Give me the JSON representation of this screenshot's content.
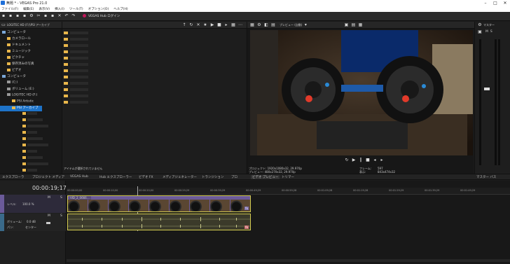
{
  "window": {
    "title": "無題 * - VEGAS Pro 21.0",
    "min": "–",
    "max": "□",
    "close": "✕"
  },
  "menu": [
    "ファイル(F)",
    "編集(E)",
    "表示(V)",
    "挿入(I)",
    "ツール(T)",
    "オプション(O)",
    "ヘルプ(H)"
  ],
  "toolbar": {
    "hub_label": "VEGAS Hub ログイン"
  },
  "explorer": {
    "path": "LOGITEC HD (F:)\\PSI アーカイブ",
    "tree": [
      {
        "label": "コンピュータ",
        "indent": 0,
        "type": "pc"
      },
      {
        "label": "カメラロール",
        "indent": 1,
        "type": "folder"
      },
      {
        "label": "ドキュメント",
        "indent": 1,
        "type": "folder"
      },
      {
        "label": "ミュージック",
        "indent": 1,
        "type": "folder"
      },
      {
        "label": "ピクチャ",
        "indent": 1,
        "type": "folder"
      },
      {
        "label": "保存済みの写真",
        "indent": 1,
        "type": "folder"
      },
      {
        "label": "ビデオ",
        "indent": 1,
        "type": "folder"
      },
      {
        "label": "コンピュータ",
        "indent": 0,
        "type": "pc"
      },
      {
        "label": "(C:)",
        "indent": 1,
        "type": "drive"
      },
      {
        "label": "ボリューム (E:)",
        "indent": 1,
        "type": "drive"
      },
      {
        "label": "LOGITEC HD (F:)",
        "indent": 1,
        "type": "drive"
      },
      {
        "label": "PSI Artistic",
        "indent": 2,
        "type": "folder"
      },
      {
        "label": "PSI アーカイブ",
        "indent": 2,
        "type": "folder",
        "selected": true
      }
    ],
    "status": "アイテムが選択されていません"
  },
  "preview": {
    "mode": "プレビュー (自動)",
    "project_label": "プロジェクト:",
    "project_value": "1920x1080x32, 29.970p",
    "preview_label": "プレビュー:",
    "preview_value": "480x270x32, 29.970p",
    "frame_label": "フレーム:",
    "frame_value": "597",
    "display_label": "表示:",
    "display_value": "843x474x32"
  },
  "master": {
    "label": "マスター",
    "m": "M",
    "s": "S",
    "bus_label": "マスター バス"
  },
  "tabs": [
    "エクスプローラ",
    "プロジェクト メディア",
    "VEGAS Hub",
    "Hub エクスプローラー",
    "ビデオ FX",
    "メディアジェネレーター",
    "トランジション",
    "プロ",
    "ビデオ プレビュー",
    "トリマー"
  ],
  "timeline": {
    "timecode": "00:00:19;17",
    "ruler": [
      "00:00:00;00",
      "00:00:10;00",
      "00:00:20;00",
      "00:00:29;29",
      "00:00:39;29",
      "00:00:49;29",
      "00:00:59;28",
      "00:01:09;28",
      "00:01:19;28",
      "00:01:29;29",
      "00:01:39;29",
      "00:01:49;29"
    ],
    "video_track": {
      "level_label": "レベル:",
      "level_value": "100.0 %",
      "clip_name": "VID_2_0666...."
    },
    "audio_track": {
      "volume_label": "ボリューム:",
      "volume_value": "0.0 dB",
      "pan_label": "パン:",
      "pan_value": "センター"
    },
    "m": "M",
    "s": "S"
  }
}
